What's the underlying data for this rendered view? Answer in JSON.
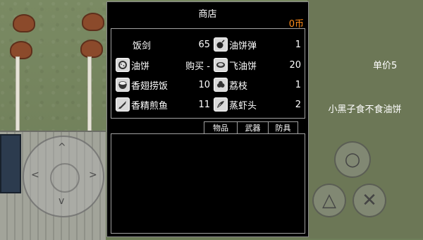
{
  "shop": {
    "title": "商店",
    "coins": "0币",
    "items": [
      {
        "name": "饭剑",
        "value": "65",
        "icon": "sword-icon"
      },
      {
        "name": "油饼弹",
        "value": "1",
        "icon": "pancake-bomb-icon"
      },
      {
        "name": "油饼",
        "value": "购买 -",
        "icon": "pancake-icon"
      },
      {
        "name": "飞油饼",
        "value": "20",
        "icon": "flying-pancake-icon"
      },
      {
        "name": "香翅捞饭",
        "value": "10",
        "icon": "rice-bowl-icon"
      },
      {
        "name": "荔枝",
        "value": "1",
        "icon": "lychee-icon"
      },
      {
        "name": "香精煎鱼",
        "value": "11",
        "icon": "fish-icon"
      },
      {
        "name": "蒸虾头",
        "value": "2",
        "icon": "shrimp-icon"
      }
    ],
    "tabs": [
      "物品",
      "武器",
      "防具"
    ]
  },
  "side": {
    "price": "单价5",
    "description": "小黑子食不食油饼"
  },
  "controls": {
    "dpad": {
      "up": "^",
      "down": "v",
      "left": "<",
      "right": ">"
    },
    "buttons": [
      "○",
      "△",
      "✕"
    ]
  }
}
